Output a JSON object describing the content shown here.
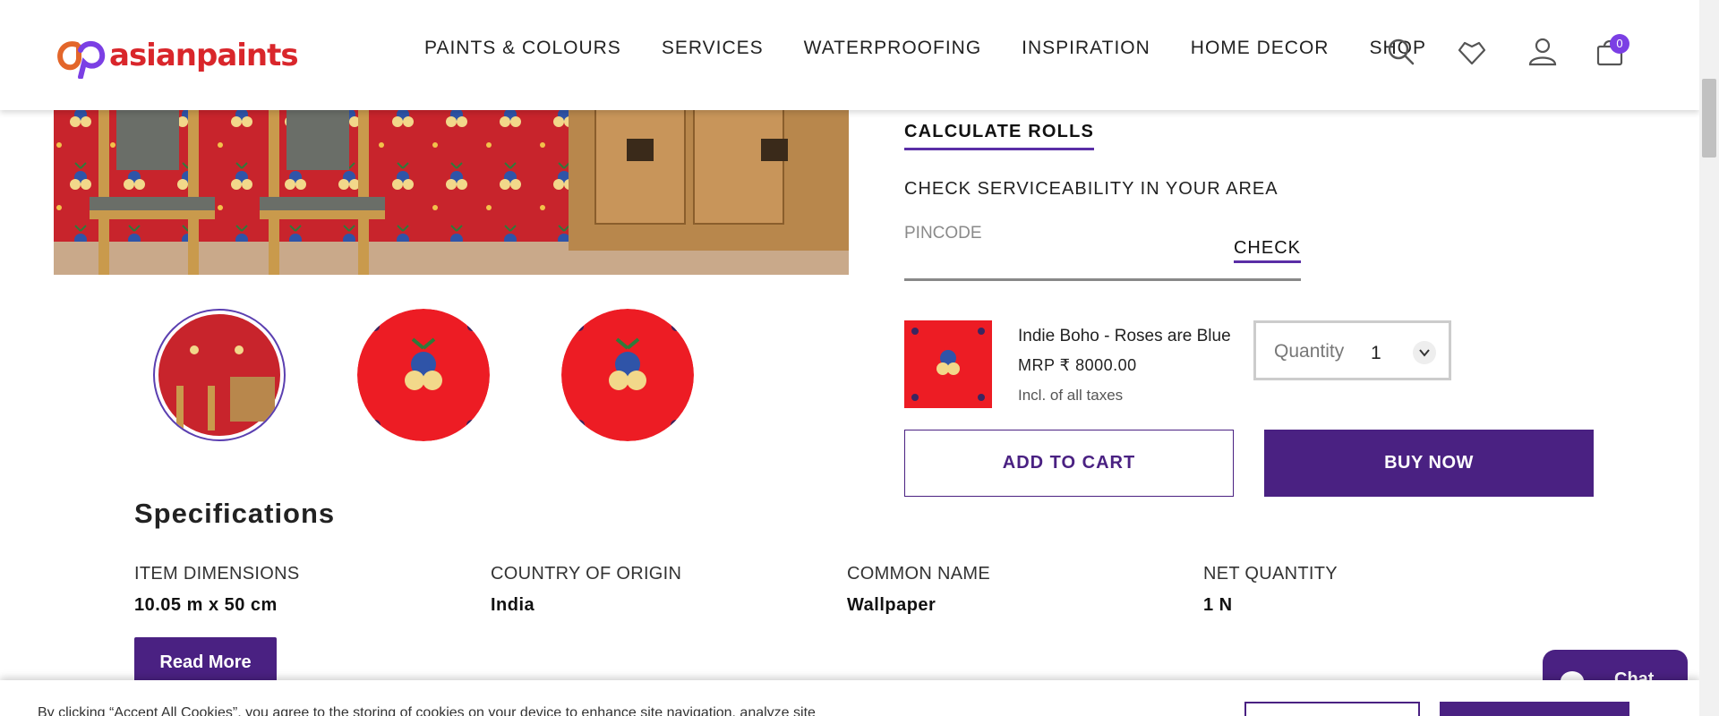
{
  "brand": {
    "name": "asianpaints",
    "color": "#d9262b"
  },
  "nav": {
    "items": [
      {
        "label": "PAINTS & COLOURS"
      },
      {
        "label": "SERVICES"
      },
      {
        "label": "WATERPROOFING"
      },
      {
        "label": "INSPIRATION"
      },
      {
        "label": "HOME DECOR"
      },
      {
        "label": "SHOP"
      }
    ]
  },
  "header_icons": {
    "search": "search-icon",
    "wishlist": "heart-icon",
    "account": "user-icon",
    "cart": "cart-icon",
    "cart_count": "0"
  },
  "gallery": {
    "hero": "wallpaper-room-image",
    "thumbnails": [
      {
        "icon": "room-thumbnail",
        "active": true
      },
      {
        "icon": "floral-pattern-thumbnail",
        "active": false
      },
      {
        "icon": "floral-pattern-thumbnail",
        "active": false
      }
    ]
  },
  "calculator": {
    "label": "CALCULATE ROLLS"
  },
  "serviceability": {
    "title": "CHECK SERVICEABILITY IN YOUR AREA",
    "pincode_placeholder": "PINCODE",
    "check_label": "CHECK"
  },
  "product": {
    "name": "Indie Boho - Roses are Blue",
    "price": "MRP ₹ 8000.00",
    "tax_note": "Incl. of all taxes",
    "quantity_label": "Quantity",
    "quantity_value": "1"
  },
  "actions": {
    "add_to_cart": "ADD TO CART",
    "buy_now": "BUY NOW"
  },
  "specifications": {
    "title": "Specifications",
    "items": [
      {
        "label": "ITEM DIMENSIONS",
        "value": "10.05 m x 50 cm"
      },
      {
        "label": "COUNTRY OF ORIGIN",
        "value": "India"
      },
      {
        "label": "COMMON NAME",
        "value": "Wallpaper"
      },
      {
        "label": "NET QUANTITY",
        "value": "1 N"
      }
    ],
    "read_more": "Read More"
  },
  "chat": {
    "label": "Chat"
  },
  "cookie": {
    "text": "By clicking “Accept All Cookies”, you agree to the storing of cookies on your device to enhance site navigation, analyze site"
  },
  "colors": {
    "primary_purple": "#4a2182",
    "accent_purple": "#5a2ea6",
    "wallpaper_red": "#c8242c"
  }
}
